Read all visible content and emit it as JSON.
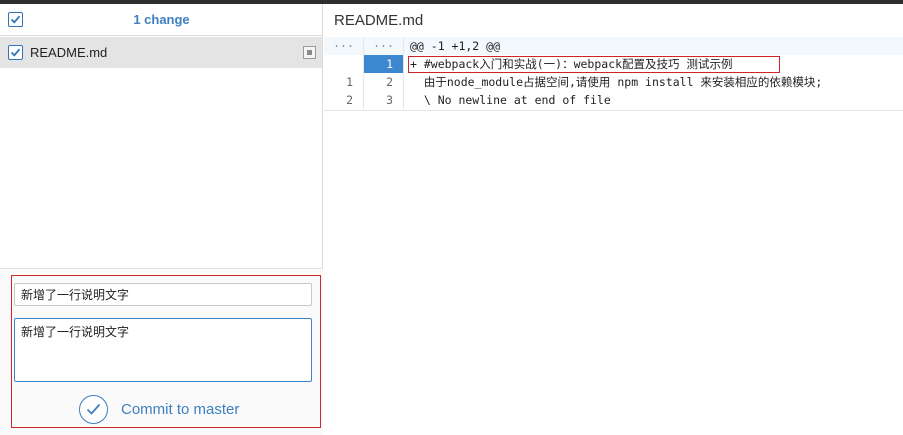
{
  "changes": {
    "header": "1 change",
    "files": [
      {
        "name": "README.md"
      }
    ]
  },
  "commit": {
    "summary": "新增了一行说明文字",
    "description": "新增了一行说明文字",
    "button_label": "Commit to master"
  },
  "diff": {
    "file_title": "README.md",
    "hunk": {
      "old_ln": "···",
      "new_ln": "···",
      "text": "@@ -1 +1,2 @@"
    },
    "lines": [
      {
        "old_ln": "",
        "new_ln": "1",
        "text": "+ #webpack入门和实战(一)：webpack配置及技巧 测试示例"
      },
      {
        "old_ln": "1",
        "new_ln": "2",
        "text": "  由于node_module占据空间,请使用 npm install 来安装相应的依赖模块;"
      },
      {
        "old_ln": "2",
        "new_ln": "3",
        "text": "  \\ No newline at end of file"
      }
    ]
  },
  "colors": {
    "accent": "#3d7fc0",
    "highlight_border": "#d0242b",
    "added_line_number_bg": "#3d86d0"
  }
}
